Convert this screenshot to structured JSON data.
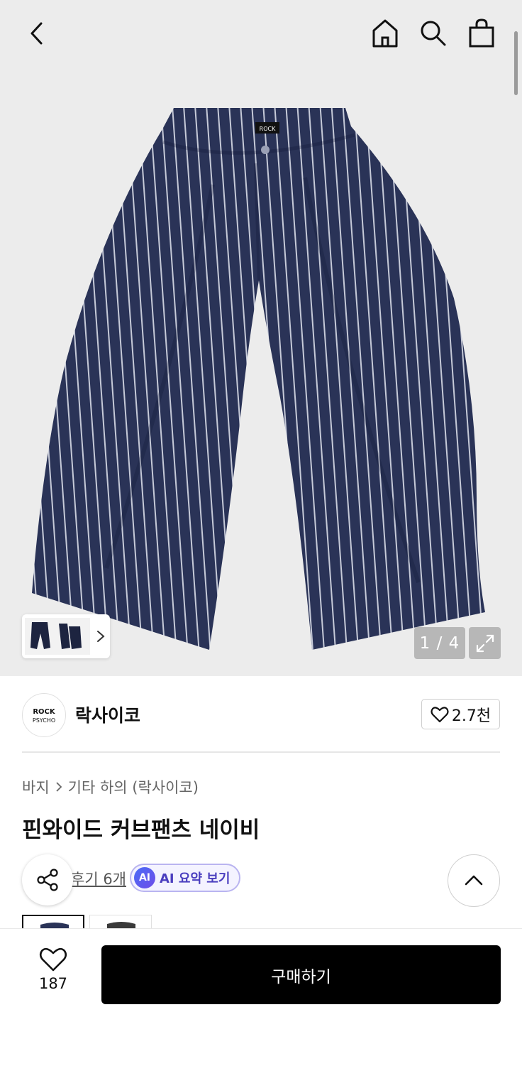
{
  "header": {
    "back_icon": "chevron-left-icon",
    "home_icon": "home-icon",
    "search_icon": "search-icon",
    "cart_icon": "shopping-bag-icon"
  },
  "gallery": {
    "counter": "1 / 4",
    "current_index": 1,
    "total": 4,
    "expand_icon": "expand-icon"
  },
  "brand": {
    "name": "락사이코",
    "logo_text": "ROCK PSYCHO",
    "like_count": "2.7천"
  },
  "breadcrumb": {
    "category": "바지",
    "subcategory": "기타 하의 (락사이코)"
  },
  "product": {
    "title": "핀와이드 커브팬츠 네이비",
    "reviews_link": "후기 6개",
    "ai_badge": "AI",
    "ai_summary_label": "AI 요약 보기"
  },
  "bottom_bar": {
    "wish_count": "187",
    "buy_label": "구매하기"
  },
  "colors": {
    "background": "#ececec",
    "pants_navy": "#2a3357",
    "stripe": "#c6cad8",
    "ai_accent": "#4b3fbf",
    "buy_bg": "#000000"
  }
}
